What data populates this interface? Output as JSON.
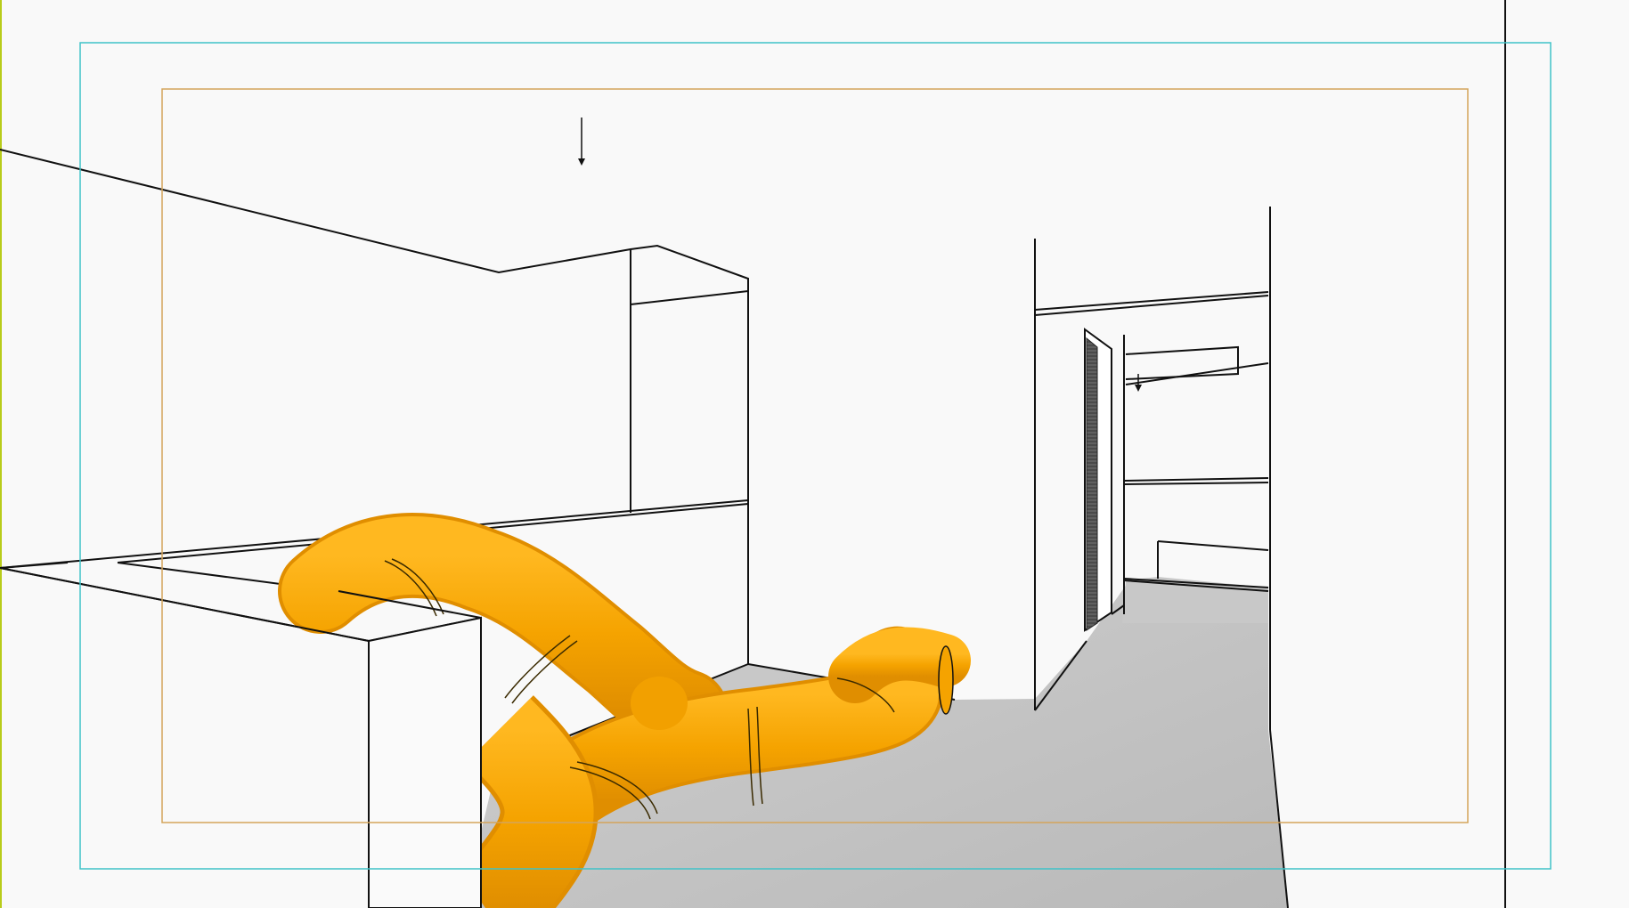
{
  "viewport": {
    "background": "#f9f9f9",
    "left_edge_accent": "#b8cc1a"
  },
  "guides": {
    "outer_frame_color": "#3fc2c8",
    "inner_frame_color": "#d4a45a"
  },
  "scene": {
    "edge_color": "#111111",
    "floor_color": "#c4c4c4",
    "tube_color": "#f5a300",
    "tube_highlight": "#ffb820",
    "tube_shadow": "#d98600",
    "door_color": "#555555"
  }
}
